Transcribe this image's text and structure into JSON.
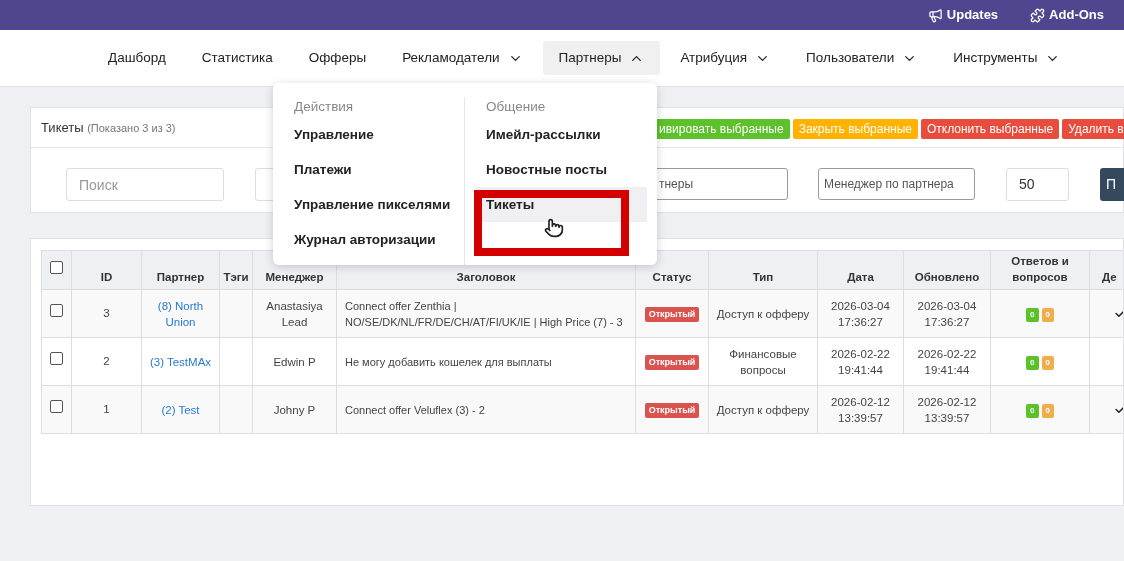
{
  "top_bar": {
    "links": [
      "Updates",
      "Add-Ons"
    ]
  },
  "nav": {
    "items": [
      {
        "label": "Дашборд",
        "has_menu": false,
        "selected": false
      },
      {
        "label": "Статистика",
        "has_menu": false,
        "selected": false
      },
      {
        "label": "Офферы",
        "has_menu": false,
        "selected": false
      },
      {
        "label": "Рекламодатели",
        "has_menu": true,
        "selected": false
      },
      {
        "label": "Партнеры",
        "has_menu": true,
        "selected": true
      },
      {
        "label": "Атрибуция",
        "has_menu": true,
        "selected": false
      },
      {
        "label": "Пользователи",
        "has_menu": true,
        "selected": false
      },
      {
        "label": "Инструменты",
        "has_menu": true,
        "selected": false
      }
    ]
  },
  "dropdown": {
    "columns": [
      {
        "heading": "Действия",
        "items": [
          {
            "label": "Управление",
            "selected": false
          },
          {
            "label": "Платежи",
            "selected": false
          },
          {
            "label": "Управление пикселями",
            "selected": false
          },
          {
            "label": "Журнал авторизации",
            "selected": false
          }
        ]
      },
      {
        "heading": "Общение",
        "items": [
          {
            "label": "Имейл-рассылки",
            "selected": false
          },
          {
            "label": "Новостные посты",
            "selected": false
          },
          {
            "label": "Тикеты",
            "selected": true
          }
        ]
      }
    ]
  },
  "tickets_panel": {
    "title": "Тикеты",
    "count_note": "(Показано 3 из 3)",
    "actions": [
      {
        "label": "ивировать выбранные",
        "color": "#5cc12a"
      },
      {
        "label": "Закрыть выбранные",
        "color": "#ffb300"
      },
      {
        "label": "Отклонить выбранные",
        "color": "#e74c3c"
      },
      {
        "label": "Удалить в",
        "color": "#e74c3c"
      }
    ],
    "filters": {
      "search_placeholder": "Поиск",
      "partners_value": "тнеры",
      "manager_placeholder": "Менеджер по партнера",
      "per_page": "50",
      "submit": "П"
    }
  },
  "table": {
    "header_checked": false,
    "columns": [
      "ID",
      "Партнер",
      "Тэги",
      "Менеджер",
      "Заголовок",
      "Статус",
      "Тип",
      "Дата",
      "Обновлено",
      "Ответов и вопросов",
      "Де"
    ],
    "rows": [
      {
        "checked": false,
        "id": "3",
        "partner": "(8) North Union",
        "manager": "Anastasiya Lead",
        "subject": "Connect offer Zenthia | NO/SE/DK/NL/FR/DE/CH/AT/FI/UK/IE | High Price (7) - 3",
        "status": "Открытый",
        "type": "Доступ к офферу",
        "date": "2026-03-04 17:36:27",
        "updated": "2026-03-04 17:36:27",
        "answers": "0",
        "questions": "0",
        "column_12_mark": true
      },
      {
        "checked": false,
        "id": "2",
        "partner": "(3) TestMAx",
        "manager": "Edwin P",
        "subject": "Не могу добавить кошелек для выплаты",
        "status": "Открытый",
        "type": "Финансовые вопросы",
        "date": "2026-02-22 19:41:44",
        "updated": "2026-02-22 19:41:44",
        "answers": "0",
        "questions": "0",
        "column_12_mark": false
      },
      {
        "checked": false,
        "id": "1",
        "partner": "(2) Test",
        "manager": "Johny P",
        "subject": "Connect offer Veluflex (3) - 2",
        "status": "Открытый",
        "type": "Доступ к офферу",
        "date": "2026-02-12 13:39:57",
        "updated": "2026-02-12 13:39:57",
        "answers": "0",
        "questions": "0",
        "column_12_mark": true
      }
    ]
  }
}
